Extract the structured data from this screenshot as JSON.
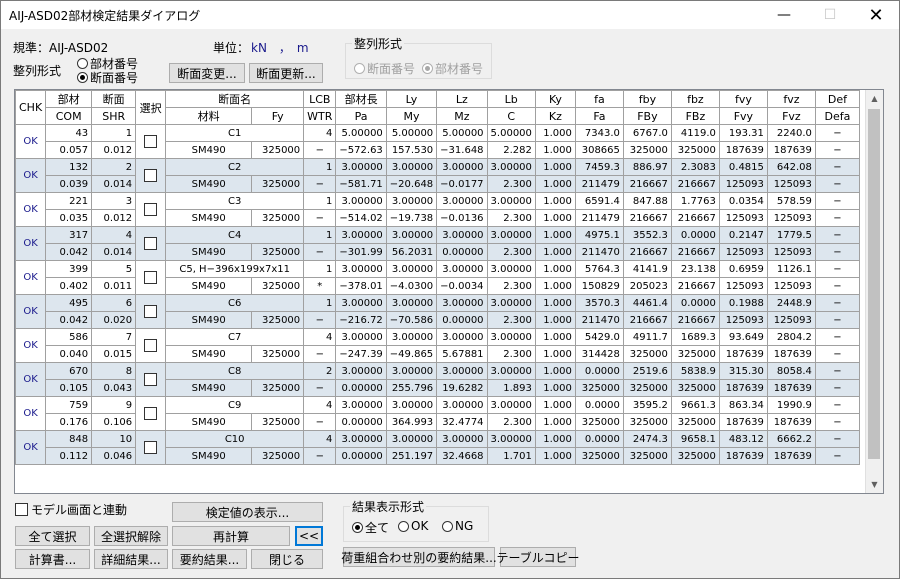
{
  "window": {
    "title": "AIJ-ASD02部材検定結果ダイアログ"
  },
  "header": {
    "standard": "規準：AIJ-ASD02",
    "unit_label": "単位：",
    "unit_value": "kN　，　m",
    "sort_label": "整列形式",
    "sort_options": [
      "部材番号",
      "断面番号"
    ],
    "sort_selected": "断面番号",
    "change_section_btn": "断面変更...",
    "update_section_btn": "断面更新...",
    "group2_title": "整列形式",
    "group2_options": [
      "断面番号",
      "部材番号"
    ],
    "group2_selected": "部材番号"
  },
  "table": {
    "header_row1": [
      "CHK",
      "部材",
      "断面",
      "選択",
      "断面名",
      "",
      "LCB",
      "部材長",
      "Ly",
      "Lz",
      "Lb",
      "Ky",
      "fa",
      "fby",
      "fbz",
      "fvy",
      "fvz",
      "Def"
    ],
    "header_row2": [
      "",
      "COM",
      "SHR",
      "",
      "材料",
      "Fy",
      "WTR",
      "Pa",
      "My",
      "Mz",
      "C",
      "Kz",
      "Fa",
      "FBy",
      "FBz",
      "Fvy",
      "Fvz",
      "Defa"
    ],
    "rows": [
      {
        "chk": "OK",
        "r1": [
          "43",
          "1",
          "C1",
          "",
          "4",
          "5.00000",
          "5.00000",
          "5.00000",
          "5.00000",
          "1.000",
          "7343.0",
          "6767.0",
          "4119.0",
          "193.31",
          "2240.0",
          "−"
        ],
        "r2": [
          "0.057",
          "0.012",
          "SM490",
          "325000",
          "−",
          "−572.63",
          "157.530",
          "−31.648",
          "2.282",
          "1.000",
          "308665",
          "325000",
          "325000",
          "187639",
          "187639",
          "−"
        ]
      },
      {
        "chk": "OK",
        "r1": [
          "132",
          "2",
          "C2",
          "",
          "1",
          "3.00000",
          "3.00000",
          "3.00000",
          "3.00000",
          "1.000",
          "7459.3",
          "886.97",
          "2.3083",
          "0.4815",
          "642.08",
          "−"
        ],
        "r2": [
          "0.039",
          "0.014",
          "SM490",
          "325000",
          "−",
          "−581.71",
          "−20.648",
          "−0.0177",
          "2.300",
          "1.000",
          "211479",
          "216667",
          "216667",
          "125093",
          "125093",
          "−"
        ]
      },
      {
        "chk": "OK",
        "r1": [
          "221",
          "3",
          "C3",
          "",
          "1",
          "3.00000",
          "3.00000",
          "3.00000",
          "3.00000",
          "1.000",
          "6591.4",
          "847.88",
          "1.7763",
          "0.0354",
          "578.59",
          "−"
        ],
        "r2": [
          "0.035",
          "0.012",
          "SM490",
          "325000",
          "−",
          "−514.02",
          "−19.738",
          "−0.0136",
          "2.300",
          "1.000",
          "211479",
          "216667",
          "216667",
          "125093",
          "125093",
          "−"
        ]
      },
      {
        "chk": "OK",
        "r1": [
          "317",
          "4",
          "C4",
          "",
          "1",
          "3.00000",
          "3.00000",
          "3.00000",
          "3.00000",
          "1.000",
          "4975.1",
          "3552.3",
          "0.0000",
          "0.2147",
          "1779.5",
          "−"
        ],
        "r2": [
          "0.042",
          "0.014",
          "SM490",
          "325000",
          "−",
          "−301.99",
          "56.2031",
          "0.00000",
          "2.300",
          "1.000",
          "211470",
          "216667",
          "216667",
          "125093",
          "125093",
          "−"
        ]
      },
      {
        "chk": "OK",
        "r1": [
          "399",
          "5",
          "C5, H−396x199x7x11",
          "",
          "1",
          "3.00000",
          "3.00000",
          "3.00000",
          "3.00000",
          "1.000",
          "5764.3",
          "4141.9",
          "23.138",
          "0.6959",
          "1126.1",
          "−"
        ],
        "r2": [
          "0.402",
          "0.011",
          "SM490",
          "325000",
          "*",
          "−378.01",
          "−4.0300",
          "−0.0034",
          "2.300",
          "1.000",
          "150829",
          "205023",
          "216667",
          "125093",
          "125093",
          "−"
        ]
      },
      {
        "chk": "OK",
        "r1": [
          "495",
          "6",
          "C6",
          "",
          "1",
          "3.00000",
          "3.00000",
          "3.00000",
          "3.00000",
          "1.000",
          "3570.3",
          "4461.4",
          "0.0000",
          "0.1988",
          "2448.9",
          "−"
        ],
        "r2": [
          "0.042",
          "0.020",
          "SM490",
          "325000",
          "−",
          "−216.72",
          "−70.586",
          "0.00000",
          "2.300",
          "1.000",
          "211470",
          "216667",
          "216667",
          "125093",
          "125093",
          "−"
        ]
      },
      {
        "chk": "OK",
        "r1": [
          "586",
          "7",
          "C7",
          "",
          "4",
          "3.00000",
          "3.00000",
          "3.00000",
          "3.00000",
          "1.000",
          "5429.0",
          "4911.7",
          "1689.3",
          "93.649",
          "2804.2",
          "−"
        ],
        "r2": [
          "0.040",
          "0.015",
          "SM490",
          "325000",
          "−",
          "−247.39",
          "−49.865",
          "5.67881",
          "2.300",
          "1.000",
          "314428",
          "325000",
          "325000",
          "187639",
          "187639",
          "−"
        ]
      },
      {
        "chk": "OK",
        "r1": [
          "670",
          "8",
          "C8",
          "",
          "2",
          "3.00000",
          "3.00000",
          "3.00000",
          "3.00000",
          "1.000",
          "0.0000",
          "2519.6",
          "5838.9",
          "315.30",
          "8058.4",
          "−"
        ],
        "r2": [
          "0.105",
          "0.043",
          "SM490",
          "325000",
          "−",
          "0.00000",
          "255.796",
          "19.6282",
          "1.893",
          "1.000",
          "325000",
          "325000",
          "325000",
          "187639",
          "187639",
          "−"
        ]
      },
      {
        "chk": "OK",
        "r1": [
          "759",
          "9",
          "C9",
          "",
          "4",
          "3.00000",
          "3.00000",
          "3.00000",
          "3.00000",
          "1.000",
          "0.0000",
          "3595.2",
          "9661.3",
          "863.34",
          "1990.9",
          "−"
        ],
        "r2": [
          "0.176",
          "0.106",
          "SM490",
          "325000",
          "−",
          "0.00000",
          "364.993",
          "32.4774",
          "2.300",
          "1.000",
          "325000",
          "325000",
          "325000",
          "187639",
          "187639",
          "−"
        ]
      },
      {
        "chk": "OK",
        "r1": [
          "848",
          "10",
          "C10",
          "",
          "4",
          "3.00000",
          "3.00000",
          "3.00000",
          "3.00000",
          "1.000",
          "0.0000",
          "2474.3",
          "9658.1",
          "483.12",
          "6662.2",
          "−"
        ],
        "r2": [
          "0.112",
          "0.046",
          "SM490",
          "325000",
          "−",
          "0.00000",
          "251.197",
          "32.4668",
          "1.701",
          "1.000",
          "325000",
          "325000",
          "325000",
          "187639",
          "187639",
          "−"
        ]
      }
    ]
  },
  "bottom": {
    "link_model_label": "モデル画面と連動",
    "show_values_btn": "検定値の表示...",
    "select_all_btn": "全て選択",
    "deselect_all_btn": "全選択解除",
    "recalc_btn": "再計算",
    "collapse_btn": "<<",
    "calc_report_btn": "計算書...",
    "detail_btn": "詳細結果...",
    "summary_btn": "要約結果...",
    "close_btn": "閉じる",
    "result_group_title": "結果表示形式",
    "result_options": [
      "全て",
      "OK",
      "NG"
    ],
    "result_selected": "全て",
    "load_combo_btn": "荷重組合わせ別の要約結果...",
    "table_copy_btn": "テーブルコピー"
  }
}
